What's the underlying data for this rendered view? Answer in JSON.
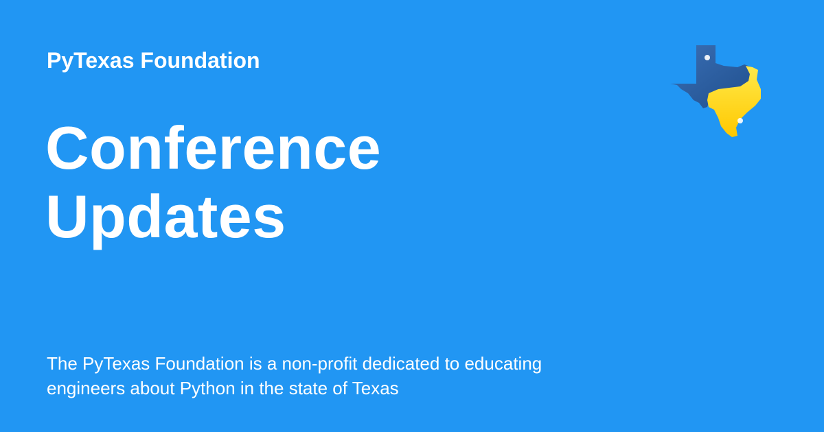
{
  "org": {
    "name": "PyTexas Foundation"
  },
  "title": {
    "line1": "Conference",
    "line2": "Updates"
  },
  "description": {
    "line1": "The PyTexas Foundation is a non-profit dedicated to educating",
    "line2": "engineers about Python in the state of Texas"
  },
  "logo": {
    "icon": "texas-python-logo-icon",
    "blue": "#2A5FA0",
    "yellow": "#FFD60A"
  },
  "colors": {
    "background": "#2196F3",
    "text": "#FFFFFF"
  }
}
